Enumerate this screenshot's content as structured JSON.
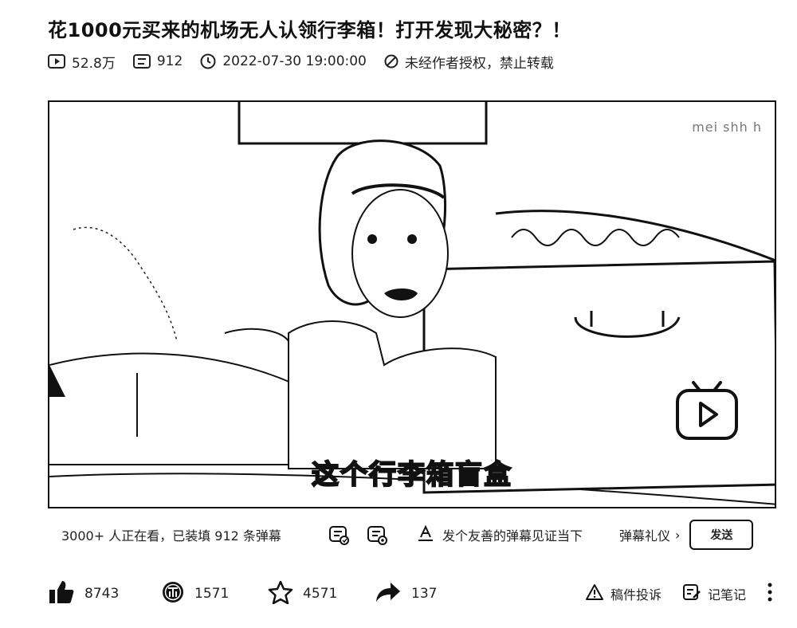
{
  "video": {
    "title": "花1000元买来的机场无人认领行李箱！打开发现大秘密？！",
    "views": "52.8万",
    "danmaku_count": "912",
    "datetime": "2022-07-30 19:00:00",
    "copyright": "未经作者授权，禁止转载"
  },
  "player": {
    "subtitle": "这个行李箱盲盒",
    "watermark": "mei shh h"
  },
  "danmaku_bar": {
    "viewers_text": "3000+ 人正在看，已装填 912 条弹幕",
    "input_placeholder": "发个友善的弹幕见证当下",
    "etiquette_label": "弹幕礼仪",
    "etiquette_chevron": "›",
    "send_label": "发送"
  },
  "actions": {
    "like_count": "8743",
    "coin_count": "1571",
    "favorite_count": "4571",
    "share_count": "137",
    "report_label": "稿件投诉",
    "notes_label": "记笔记"
  },
  "icons": {
    "views": "play-box-icon",
    "danmaku": "danmaku-list-icon",
    "time": "clock-icon",
    "copyright": "no-entry-icon",
    "like": "thumbs-up-icon",
    "coin": "coin-icon",
    "favorite": "star-icon",
    "share": "share-arrow-icon",
    "report": "warning-icon",
    "notes": "note-edit-icon",
    "more": "more-vertical-icon"
  },
  "colors": {
    "text": "#111111",
    "muted": "#777777",
    "background": "#ffffff"
  }
}
